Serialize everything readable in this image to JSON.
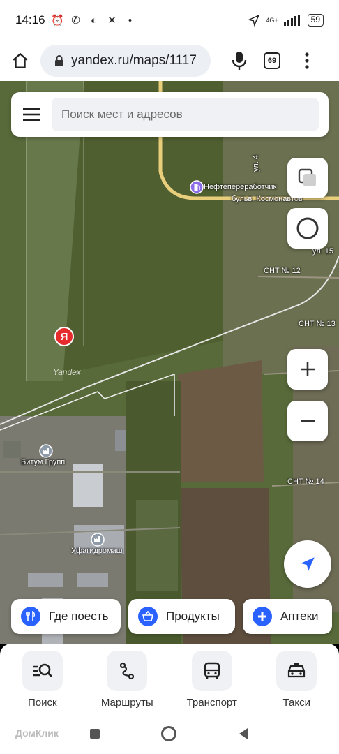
{
  "status_bar": {
    "time": "14:16",
    "icons": [
      "alarm-icon",
      "whatsapp-icon",
      "vpn-icon",
      "cross-app-icon",
      "more-dots-icon"
    ],
    "network": "4G+",
    "battery": "59"
  },
  "browser": {
    "url": "yandex.ru/maps/1117",
    "tab_count": "69"
  },
  "map": {
    "search_placeholder": "Поиск мест и адресов",
    "labels": {
      "poi_refinery": "Нефтепереработчик",
      "street_kosmonavtov": "бульв. Космонавтов",
      "street_4": "ул. 4",
      "street_15": "ул. 15",
      "snt_12": "СНТ № 12",
      "snt_13": "СНТ № 13",
      "snt_14": "СНТ № 14",
      "bitum": "Битум Групп",
      "ufagidromash": "Уфагидромаш",
      "watermark": "Yandex",
      "pin_letter": "Я"
    }
  },
  "chips": [
    {
      "label": "Где поесть",
      "color": "#2962ff"
    },
    {
      "label": "Продукты",
      "color": "#2962ff"
    },
    {
      "label": "Аптеки",
      "color": "#2962ff"
    }
  ],
  "bottom_tabs": [
    {
      "label": "Поиск"
    },
    {
      "label": "Маршруты"
    },
    {
      "label": "Транспорт"
    },
    {
      "label": "Такси"
    }
  ],
  "nav_watermark": "ДомКлик",
  "colors": {
    "accent": "#2962ff",
    "yandex_red": "#e52b2b",
    "road_yellow": "#e9cf7c"
  }
}
